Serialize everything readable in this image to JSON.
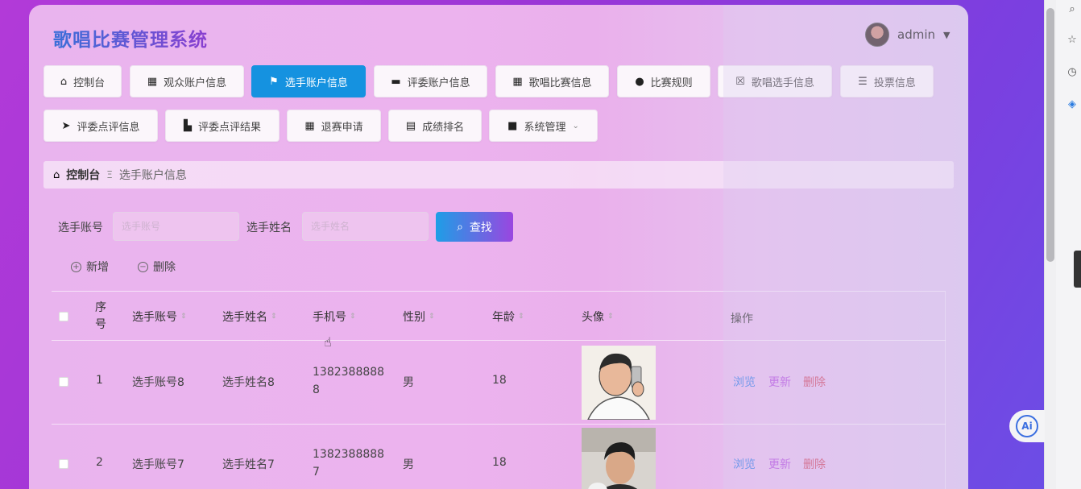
{
  "app": {
    "title": "歌唱比赛管理系统"
  },
  "user": {
    "name": "admin"
  },
  "nav": [
    {
      "label": "控制台",
      "icon": "home-icon"
    },
    {
      "label": "观众账户信息",
      "icon": "grid-icon"
    },
    {
      "label": "选手账户信息",
      "icon": "flag-icon",
      "active": true
    },
    {
      "label": "评委账户信息",
      "icon": "briefcase-icon"
    },
    {
      "label": "歌唱比赛信息",
      "icon": "grid-icon"
    },
    {
      "label": "比赛规则",
      "icon": "person-icon"
    },
    {
      "label": "歌唱选手信息",
      "icon": "clipboard-x-icon"
    },
    {
      "label": "投票信息",
      "icon": "sliders-icon"
    },
    {
      "label": "评委点评信息",
      "icon": "paper-plane-icon"
    },
    {
      "label": "评委点评结果",
      "icon": "thumbs-up-icon"
    },
    {
      "label": "退赛申请",
      "icon": "grid-icon"
    },
    {
      "label": "成绩排名",
      "icon": "clipboard-icon"
    },
    {
      "label": "系统管理",
      "icon": "video-icon"
    }
  ],
  "breadcrumb": {
    "home": "控制台",
    "separator": "Ξ",
    "current": "选手账户信息"
  },
  "search": {
    "account_label": "选手账号",
    "account_placeholder": "选手账号",
    "name_label": "选手姓名",
    "name_placeholder": "选手姓名",
    "button": "查找"
  },
  "actions": {
    "add": "新增",
    "delete": "删除"
  },
  "table": {
    "headers": {
      "index": "序号",
      "account": "选手账号",
      "name": "选手姓名",
      "phone": "手机号",
      "gender": "性别",
      "age": "年龄",
      "avatar": "头像",
      "ops": "操作"
    },
    "rows": [
      {
        "index": "1",
        "account": "选手账号8",
        "name": "选手姓名8",
        "phone_line1": "1382388888",
        "phone_line2": "8",
        "gender": "男",
        "age": "18"
      },
      {
        "index": "2",
        "account": "选手账号7",
        "name": "选手姓名7",
        "phone_line1": "1382388888",
        "phone_line2": "7",
        "gender": "男",
        "age": "18"
      }
    ],
    "op_labels": {
      "view": "浏览",
      "edit": "更新",
      "delete": "删除"
    }
  },
  "colors": {
    "active_tab": "#1592e0",
    "view_link": "#3d7ee8",
    "edit_link": "#b64fe0",
    "delete_link": "#d04a6a"
  }
}
